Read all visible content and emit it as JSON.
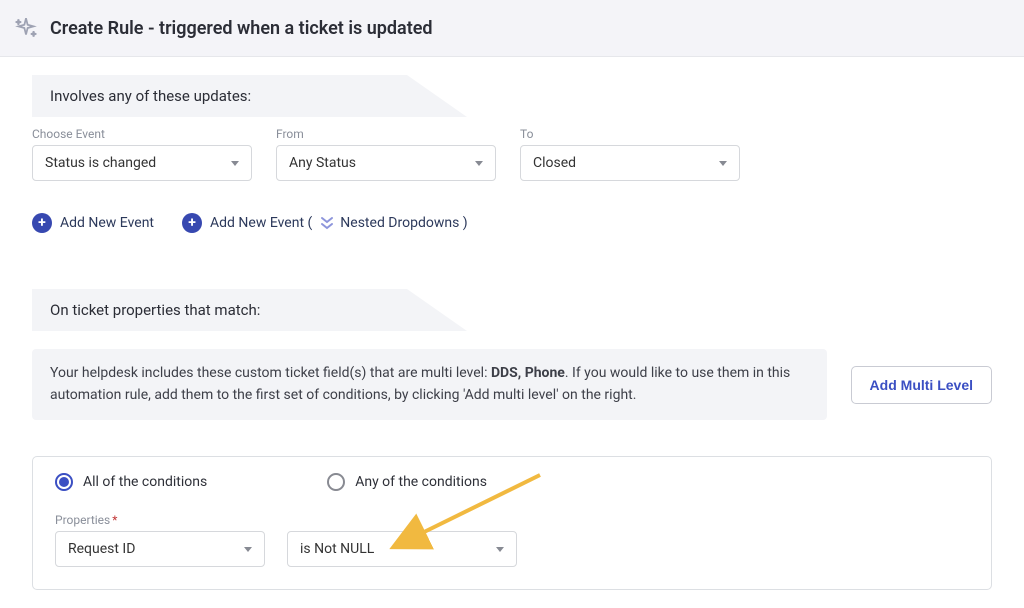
{
  "header": {
    "title": "Create Rule - triggered when a ticket is updated"
  },
  "updates": {
    "section_title": "Involves any of these updates:",
    "event_label": "Choose Event",
    "event_value": "Status is changed",
    "from_label": "From",
    "from_value": "Any Status",
    "to_label": "To",
    "to_value": "Closed",
    "add_event_label": "Add New Event",
    "add_event_nested_label": "Add New Event (",
    "nested_text": "Nested Dropdowns )"
  },
  "properties": {
    "section_title": "On ticket properties that match:",
    "info_prefix": "Your helpdesk includes these custom ticket field(s) that are multi level: ",
    "info_bold": "DDS, Phone",
    "info_suffix": ". If you would like to use them in this automation rule, add them to the first set of conditions, by clicking 'Add multi level' on the right.",
    "add_multi_label": "Add Multi Level"
  },
  "conditions": {
    "all_label": "All of the conditions",
    "any_label": "Any of the conditions",
    "selected": "all",
    "prop_label": "Properties",
    "prop_value": "Request ID",
    "op_value": "is Not NULL"
  }
}
